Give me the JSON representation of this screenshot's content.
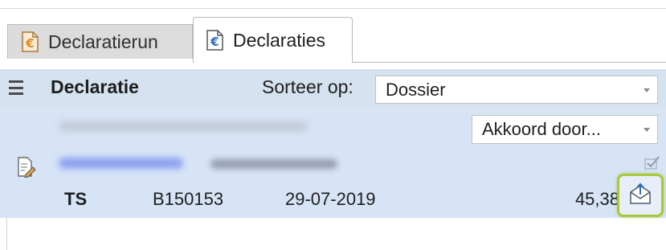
{
  "tabs": [
    {
      "label": "Declaratierun",
      "icon": "euro-document-icon",
      "active": false
    },
    {
      "label": "Declaraties",
      "icon": "euro-document-icon",
      "active": true
    }
  ],
  "header": {
    "title": "Declaratie",
    "sort_label": "Sorteer op:",
    "sort_value": "Dossier"
  },
  "record": {
    "status_value": "Akkoord door...",
    "ts": "TS",
    "number": "B150153",
    "date": "29-07-2019",
    "amount": "45,38"
  },
  "colors": {
    "header_bg": "#d5e2ef",
    "card_bg": "#d6e4f6",
    "highlight_border": "#a8c83a",
    "euro_orange": "#e08a1e",
    "euro_blue": "#2f6fb5"
  }
}
